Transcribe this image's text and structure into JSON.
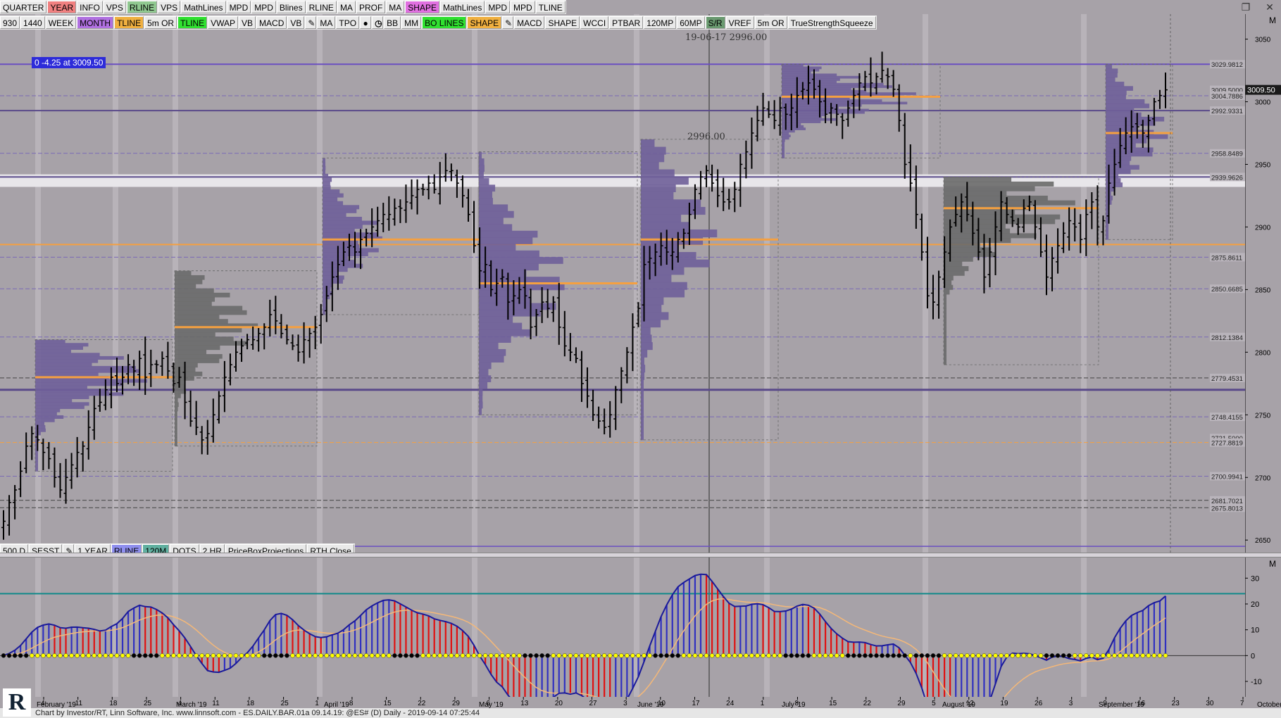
{
  "toolbar_top": [
    "QUARTER",
    "YEAR",
    "INFO",
    "VPS",
    "RLINE",
    "VPS",
    "MathLines",
    "MPD",
    "MPD",
    "Blines",
    "RLINE",
    "MA",
    "PROF",
    "MA",
    "SHAPE",
    "MathLines",
    "MPD",
    "MPD",
    "TLINE"
  ],
  "toolbar_top_colors": {
    "YEAR": "#f08080",
    "RLINE": "#90c890",
    "SHAPE": "#e070e0"
  },
  "toolbar_second": [
    "930",
    "1440",
    "WEEK",
    "MONTH",
    "TLINE",
    "5m OR",
    "TLINE",
    "VWAP",
    "VB",
    "MACD",
    "VB",
    "pencil-icon",
    "MA",
    "TPO",
    "drop-icon",
    "clock-icon",
    "BB",
    "MM",
    "BO LINES",
    "SHAPE",
    "pencil-icon",
    "MACD",
    "SHAPE",
    "WCCI",
    "PTBAR",
    "120MP",
    "60MP",
    "S/R",
    "VREF",
    "5m OR",
    "TrueStrengthSqueeze"
  ],
  "toolbar_second_colors": {
    "MONTH": "#b070e0",
    "TLINE": "#f0b040",
    "TLINE#2": "#30e030",
    "BO LINES": "#30e030",
    "SHAPE": "#f0b040",
    "S/R": "#6a9a70"
  },
  "toolbar_bottom": [
    "500 D",
    "SESST",
    "pencil-icon",
    "1 YEAR",
    "RLINE",
    "120M",
    "DOTS",
    "2 HR",
    "PriceBoxProjections",
    "RTH Close"
  ],
  "toolbar_bottom_colors": {
    "RLINE": "#8f8fef",
    "120M": "#60b0a0"
  },
  "window_controls": [
    "restore-icon",
    "close-icon"
  ],
  "crosshair_label": {
    "date": "19-06-17",
    "value": "2996.00"
  },
  "level_label": "2996.00",
  "info_box": "0  -4.25 at 3009.50",
  "price_axis_ticks": [
    "3050",
    "3000",
    "2950",
    "2900",
    "2850",
    "2800",
    "2750",
    "2700",
    "2650"
  ],
  "price_axis_tags": [
    "3029.9812",
    "3009.5000",
    "3004.7886",
    "2992.9331",
    "2958.8489",
    "2939.9626",
    "2875.8611",
    "2850.6685",
    "2812.1384",
    "2779.4531",
    "2748.4155",
    "2731.5000",
    "2727.8819",
    "2700.9941",
    "2681.7021",
    "2675.8013"
  ],
  "current_price": "3009.50",
  "panel_marker": "M",
  "osc_axis_ticks": [
    "30",
    "20",
    "10",
    "0",
    "-10"
  ],
  "date_axis": [
    "4",
    "11",
    "18",
    "25",
    "4",
    "11",
    "18",
    "25",
    "1",
    "8",
    "15",
    "22",
    "29",
    "6",
    "13",
    "20",
    "27",
    "3",
    "10",
    "17",
    "24",
    "1",
    "8",
    "15",
    "22",
    "29",
    "5",
    "12",
    "19",
    "26",
    "3",
    "9",
    "16",
    "23",
    "30",
    "7"
  ],
  "month_labels": [
    "February '19",
    "March '19",
    "April '19",
    "May '19",
    "June '19",
    "July '19",
    "August '19",
    "September '19",
    "October '"
  ],
  "status_text": "Chart by Investor/RT, Linn Software, Inc.  www.linnsoft.com - ES.DAILY.BAR.01a   09.14.19: @ES# (D) Daily - 2019-09-14 07:25:44",
  "logo_text": "R",
  "colors": {
    "background": "#a7a2a8",
    "bar": "#000000",
    "profile_purple": "#6f5f99",
    "profile_grey": "#6a6a6a",
    "orange_level": "#f5a040",
    "purple_level": "#6a4fc0",
    "osc_blue": "#3030c0",
    "osc_red": "#e01010",
    "osc_dot_yellow": "#ffff00",
    "teal_line": "#138a8a"
  },
  "chart_data": {
    "type": "candlestick",
    "symbol": "ES",
    "timeframe": "Daily",
    "ylim": [
      2640,
      3070
    ],
    "closes": [
      2665,
      2680,
      2690,
      2705,
      2725,
      2735,
      2730,
      2720,
      2715,
      2700,
      2690,
      2700,
      2710,
      2720,
      2725,
      2740,
      2755,
      2760,
      2770,
      2780,
      2775,
      2780,
      2790,
      2785,
      2795,
      2780,
      2790,
      2790,
      2795,
      2785,
      2775,
      2780,
      2760,
      2745,
      2740,
      2730,
      2735,
      2750,
      2765,
      2780,
      2790,
      2800,
      2805,
      2810,
      2810,
      2815,
      2820,
      2830,
      2825,
      2815,
      2810,
      2805,
      2800,
      2810,
      2815,
      2820,
      2830,
      2845,
      2860,
      2870,
      2880,
      2885,
      2880,
      2890,
      2895,
      2900,
      2905,
      2910,
      2910,
      2915,
      2915,
      2920,
      2925,
      2930,
      2930,
      2935,
      2930,
      2940,
      2945,
      2945,
      2935,
      2925,
      2910,
      2885,
      2865,
      2870,
      2850,
      2855,
      2860,
      2840,
      2845,
      2850,
      2845,
      2820,
      2830,
      2840,
      2835,
      2840,
      2820,
      2805,
      2800,
      2795,
      2775,
      2765,
      2750,
      2745,
      2740,
      2750,
      2770,
      2785,
      2800,
      2820,
      2835,
      2870,
      2875,
      2880,
      2885,
      2880,
      2880,
      2890,
      2895,
      2910,
      2930,
      2940,
      2945,
      2935,
      2925,
      2920,
      2920,
      2930,
      2950,
      2960,
      2975,
      2985,
      2995,
      2990,
      2985,
      2995,
      2990,
      2995,
      3005,
      3010,
      3015,
      3010,
      3000,
      2990,
      2995,
      2990,
      2985,
      2995,
      3005,
      3015,
      3020,
      3015,
      3020,
      3025,
      3020,
      3010,
      2985,
      2950,
      2935,
      2910,
      2880,
      2845,
      2840,
      2860,
      2880,
      2900,
      2910,
      2920,
      2910,
      2895,
      2880,
      2860,
      2880,
      2900,
      2920,
      2910,
      2905,
      2900,
      2915,
      2920,
      2900,
      2880,
      2860,
      2875,
      2885,
      2895,
      2905,
      2900,
      2890,
      2910,
      2920,
      2900,
      2905,
      2935,
      2950,
      2965,
      2975,
      2980,
      2980,
      2975,
      2985,
      3000,
      3005,
      3009.5
    ]
  },
  "oscillator_data": {
    "type": "bar",
    "zero_line": 0,
    "signal_line_level": 24,
    "ylim": [
      -16,
      38
    ]
  }
}
